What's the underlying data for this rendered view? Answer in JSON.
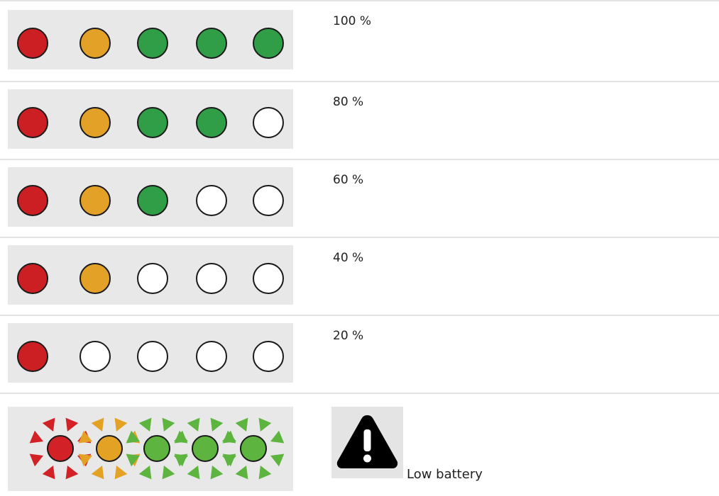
{
  "colors": {
    "red": "#cc1f24",
    "orange": "#e3a227",
    "green": "#2f9e47",
    "blink_red": "#d22227",
    "blink_orange": "#e4a225",
    "blink_green": "#5db43e",
    "off": "#ffffff",
    "panel": "#e8e8e8"
  },
  "rows": [
    {
      "label": "100 %",
      "leds": [
        "red",
        "orange",
        "green",
        "green",
        "green"
      ]
    },
    {
      "label": "80 %",
      "leds": [
        "red",
        "orange",
        "green",
        "green",
        "off"
      ]
    },
    {
      "label": "60 %",
      "leds": [
        "red",
        "orange",
        "green",
        "off",
        "off"
      ]
    },
    {
      "label": "40 %",
      "leds": [
        "red",
        "orange",
        "off",
        "off",
        "off"
      ]
    },
    {
      "label": "20 %",
      "leds": [
        "red",
        "off",
        "off",
        "off",
        "off"
      ]
    }
  ],
  "blinking_row": {
    "leds": [
      "blink_red",
      "blink_orange",
      "blink_green",
      "blink_green",
      "blink_green"
    ],
    "warning_icon": "exclamation-triangle-icon",
    "label": "Low battery"
  }
}
